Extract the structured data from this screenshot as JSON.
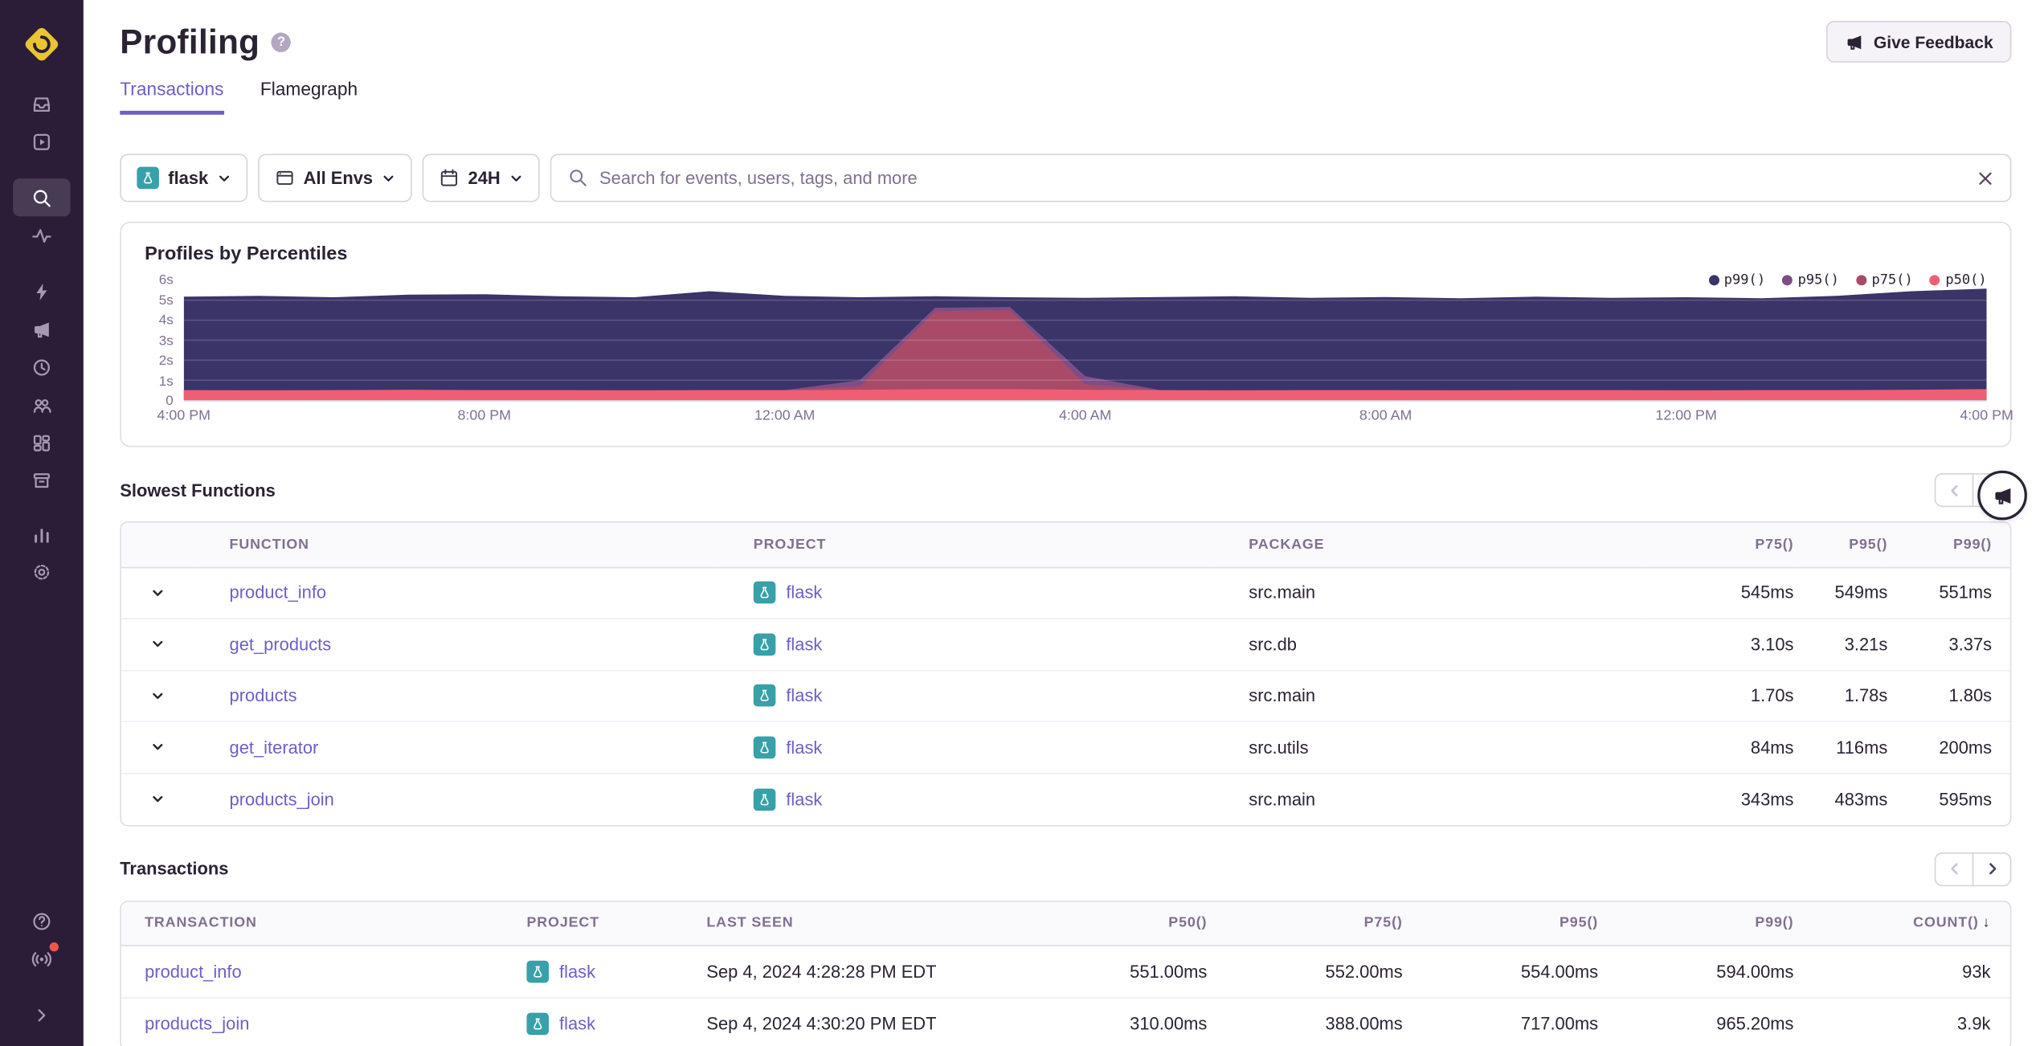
{
  "header": {
    "title": "Profiling",
    "help_icon": "?",
    "feedback_button_label": "Give Feedback"
  },
  "tabs": {
    "items": [
      {
        "label": "Transactions",
        "active": true
      },
      {
        "label": "Flamegraph",
        "active": false
      }
    ]
  },
  "filters": {
    "project_label": "flask",
    "env_label": "All Envs",
    "range_label": "24H",
    "search_placeholder": "Search for events, users, tags, and more"
  },
  "chart": {
    "title": "Profiles by Percentiles",
    "chart_data": {
      "type": "area",
      "title": "Profiles by Percentiles",
      "unit": "seconds",
      "ylim": [
        0,
        6
      ],
      "y_ticks": [
        "6s",
        "5s",
        "4s",
        "3s",
        "2s",
        "1s",
        "0"
      ],
      "x_ticks": [
        "4:00 PM",
        "8:00 PM",
        "12:00 AM",
        "4:00 AM",
        "8:00 AM",
        "12:00 PM",
        "4:00 PM"
      ],
      "legend_position": "top-right",
      "grid": true,
      "series": [
        {
          "name": "p99()",
          "color": "#3a3468",
          "values": [
            5.18,
            5.22,
            5.15,
            5.28,
            5.3,
            5.2,
            5.15,
            5.45,
            5.22,
            5.15,
            5.2,
            5.15,
            5.12,
            5.16,
            5.2,
            5.12,
            5.16,
            5.1,
            5.18,
            5.12,
            5.15,
            5.1,
            5.22,
            5.45,
            5.58
          ]
        },
        {
          "name": "p95()",
          "color": "#7d4e85",
          "values": [
            0.5,
            0.5,
            0.5,
            0.5,
            0.5,
            0.5,
            0.5,
            0.5,
            0.5,
            1.0,
            4.62,
            4.66,
            1.2,
            0.5,
            0.5,
            0.5,
            0.5,
            0.5,
            0.5,
            0.5,
            0.5,
            0.5,
            0.5,
            0.5,
            0.55
          ]
        },
        {
          "name": "p75()",
          "color": "#a84a68",
          "values": [
            0.5,
            0.5,
            0.5,
            0.5,
            0.5,
            0.5,
            0.5,
            0.5,
            0.5,
            0.7,
            4.45,
            4.5,
            0.8,
            0.5,
            0.5,
            0.5,
            0.5,
            0.5,
            0.5,
            0.5,
            0.5,
            0.5,
            0.5,
            0.5,
            0.5
          ]
        },
        {
          "name": "p50()",
          "color": "#ef5e72",
          "values": [
            0.5,
            0.48,
            0.5,
            0.52,
            0.5,
            0.5,
            0.48,
            0.5,
            0.5,
            0.52,
            0.55,
            0.55,
            0.52,
            0.5,
            0.48,
            0.5,
            0.5,
            0.48,
            0.5,
            0.5,
            0.48,
            0.5,
            0.5,
            0.52,
            0.55
          ]
        }
      ]
    }
  },
  "slowest_functions": {
    "title": "Slowest Functions",
    "columns": [
      "FUNCTION",
      "PROJECT",
      "PACKAGE",
      "P75()",
      "P95()",
      "P99()"
    ],
    "rows": [
      {
        "function": "product_info",
        "project": "flask",
        "package": "src.main",
        "p75": "545ms",
        "p95": "549ms",
        "p99": "551ms"
      },
      {
        "function": "get_products",
        "project": "flask",
        "package": "src.db",
        "p75": "3.10s",
        "p95": "3.21s",
        "p99": "3.37s"
      },
      {
        "function": "products",
        "project": "flask",
        "package": "src.main",
        "p75": "1.70s",
        "p95": "1.78s",
        "p99": "1.80s"
      },
      {
        "function": "get_iterator",
        "project": "flask",
        "package": "src.utils",
        "p75": "84ms",
        "p95": "116ms",
        "p99": "200ms"
      },
      {
        "function": "products_join",
        "project": "flask",
        "package": "src.main",
        "p75": "343ms",
        "p95": "483ms",
        "p99": "595ms"
      }
    ]
  },
  "transactions": {
    "title": "Transactions",
    "columns": [
      "TRANSACTION",
      "PROJECT",
      "LAST SEEN",
      "P50()",
      "P75()",
      "P95()",
      "P99()",
      "COUNT()"
    ],
    "sort_indicator": "↓",
    "rows": [
      {
        "transaction": "product_info",
        "project": "flask",
        "last_seen": "Sep 4, 2024 4:28:28 PM EDT",
        "p50": "551.00ms",
        "p75": "552.00ms",
        "p95": "554.00ms",
        "p99": "594.00ms",
        "count": "93k"
      },
      {
        "transaction": "products_join",
        "project": "flask",
        "last_seen": "Sep 4, 2024 4:30:20 PM EDT",
        "p50": "310.00ms",
        "p75": "388.00ms",
        "p95": "717.00ms",
        "p99": "965.20ms",
        "count": "3.9k"
      }
    ]
  }
}
